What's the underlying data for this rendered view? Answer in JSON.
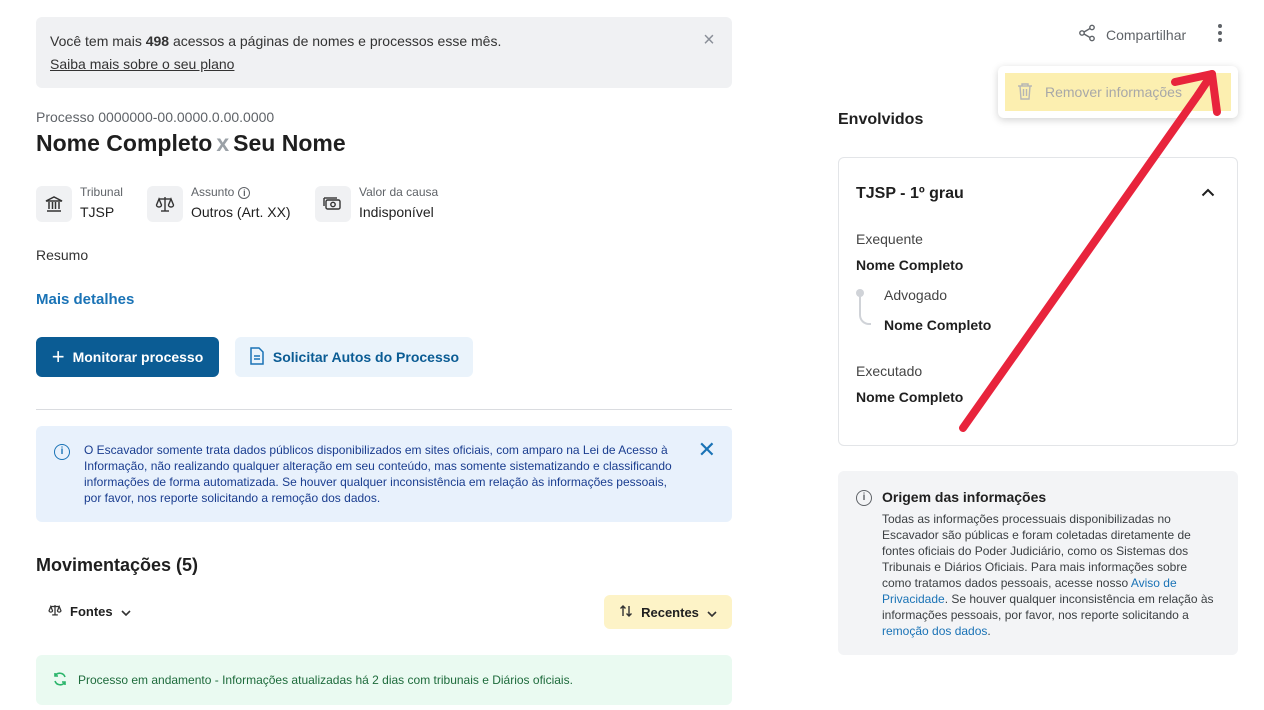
{
  "banner": {
    "text_before": "Você tem mais ",
    "count": "498",
    "text_after": " acessos a páginas de nomes e processos esse mês.",
    "link": "Saiba mais sobre o seu plano",
    "close_icon": "close-icon"
  },
  "process": {
    "number": "Processo 0000000-00.0000.0.00.0000",
    "party_a": "Nome Completo",
    "versus": "x",
    "party_b": "Seu Nome"
  },
  "meta": {
    "tribunal_label": "Tribunal",
    "tribunal_value": "TJSP",
    "assunto_label": "Assunto",
    "assunto_value": "Outros (Art. XX)",
    "valor_label": "Valor da causa",
    "valor_value": "Indisponível"
  },
  "resumo_label": "Resumo",
  "mais_detalhes": "Mais detalhes",
  "actions": {
    "monitor": "Monitorar processo",
    "request": "Solicitar Autos do Processo"
  },
  "notice": {
    "text": "O Escavador somente trata dados públicos disponibilizados em sites oficiais, com amparo na Lei de Acesso à Informação, não realizando qualquer alteração em seu conteúdo, mas somente sistematizando e classificando informações de forma automatizada. Se houver qualquer inconsistência em relação às informações pessoais, por favor, nos reporte solicitando a remoção dos dados."
  },
  "movements": {
    "title": "Movimentações (5)",
    "filter_label": "Fontes",
    "sort_label": "Recentes",
    "status": "Processo em andamento - Informações atualizadas há 2 dias com tribunais e Diários oficiais."
  },
  "header": {
    "share_label": "Compartilhar"
  },
  "dropdown": {
    "remove_label": "Remover informações"
  },
  "involved": {
    "title": "Envolvidos",
    "court": "TJSP - 1º grau",
    "exequente_label": "Exequente",
    "exequente_name": "Nome Completo",
    "advogado_label": "Advogado",
    "advogado_name": "Nome Completo",
    "executado_label": "Executado",
    "executado_name": "Nome Completo"
  },
  "origin": {
    "title": "Origem das informações",
    "body_1": "Todas as informações processuais disponibilizadas no Escavador são públicas e foram coletadas diretamente de fontes oficiais do Poder Judiciário, como os Sistemas dos Tribunais e Diários Oficiais. Para mais informações sobre como tratamos dados pessoais, acesse nosso ",
    "privacy_link": "Aviso de Privacidade",
    "body_2": ". Se houver qualquer inconsistência em relação às informações pessoais, por favor, nos reporte solicitando a ",
    "removal_link": "remoção dos dados",
    "body_3": "."
  },
  "colors": {
    "primary": "#0b5c94",
    "link": "#1a73b6",
    "highlight": "#fcefb0",
    "arrow": "#e8243c"
  }
}
